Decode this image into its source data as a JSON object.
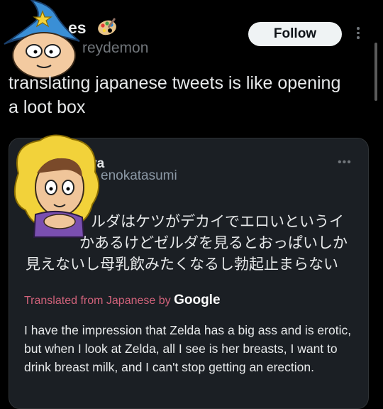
{
  "header": {
    "display_name_fragment": "es",
    "handle_fragment": "reydemon",
    "follow_label": "Follow"
  },
  "tweet": {
    "text": "translating japanese tweets is like opening a loot box"
  },
  "quoted": {
    "name_fragment": "va",
    "handle_fragment": "enokatasumi",
    "jp_lines": [
      "ルダはケツがデカイでエロいというイ",
      "かあるけどゼルダを見るとおっぱいしか",
      "見えないし母乳飲みたくなるし勃起止まらない"
    ],
    "translated_prefix": "Translated from Japanese by",
    "translated_brand": "Google",
    "translation": "I have the impression that Zelda has a big ass and is erotic, but when I look at Zelda, all I see is her breasts, I want to drink breast milk, and I can't stop getting an erection."
  },
  "icons": {
    "wizard_avatar": "cartoon-wizard-avatar",
    "blonde_avatar": "cartoon-blonde-avatar",
    "palette": "artist-palette-emoji",
    "more": "more-options-icon"
  },
  "colors": {
    "background": "#000000",
    "card": "#1b1f24",
    "follow_bg": "#eff3f4",
    "translated_label": "#d0627a",
    "muted": "#71767b"
  }
}
